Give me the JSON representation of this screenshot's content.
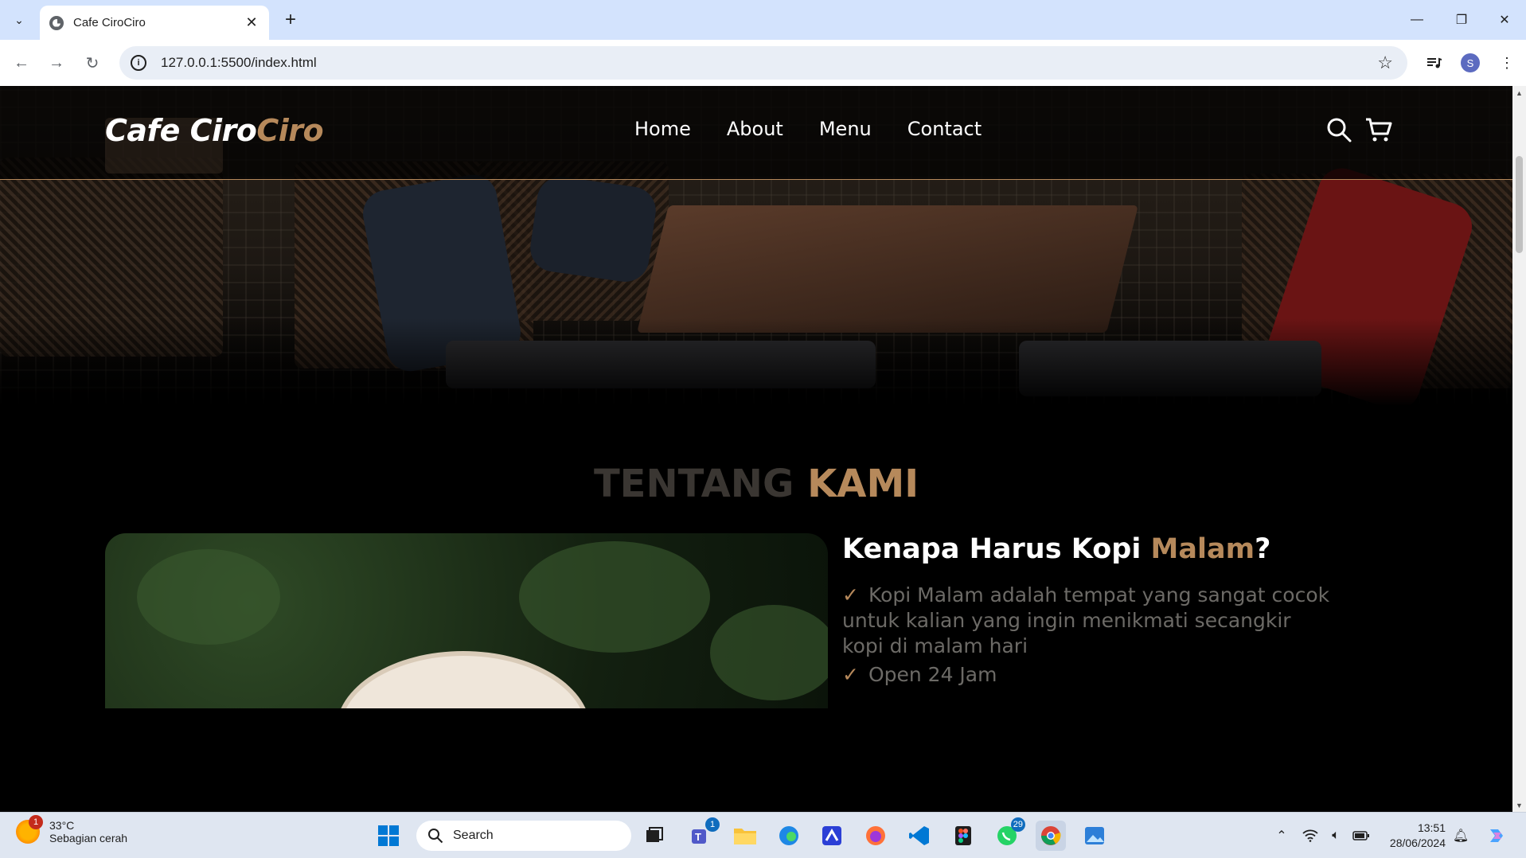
{
  "browser": {
    "tab_title": "Cafe CiroCiro",
    "tab_close": "✕",
    "new_tab": "+",
    "url": "127.0.0.1:5500/index.html",
    "window_min": "—",
    "window_restore": "❐",
    "window_close": "✕",
    "profile_initial": "S"
  },
  "site": {
    "brand_main": "Cafe Ciro",
    "brand_accent": "Ciro",
    "nav": [
      "Home",
      "About",
      "Menu",
      "Contact"
    ],
    "accent_color": "#b6895b"
  },
  "about": {
    "title_muted": "TENTANG ",
    "title_gold": "KAMI",
    "heading_main": "Kenapa Harus Kopi ",
    "heading_gold": "Malam",
    "heading_end": "?",
    "check": "✓",
    "points": [
      "Kopi Malam adalah tempat yang sangat cocok untuk kalian yang ingin menikmati secangkir kopi di malam hari",
      "Open 24 Jam"
    ]
  },
  "taskbar": {
    "weather_badge": "1",
    "temperature": "33°C",
    "weather_desc": "Sebagian cerah",
    "search_label": "Search",
    "teams_badge": "1",
    "whatsapp_badge": "29",
    "time": "13:51",
    "date": "28/06/2024"
  }
}
